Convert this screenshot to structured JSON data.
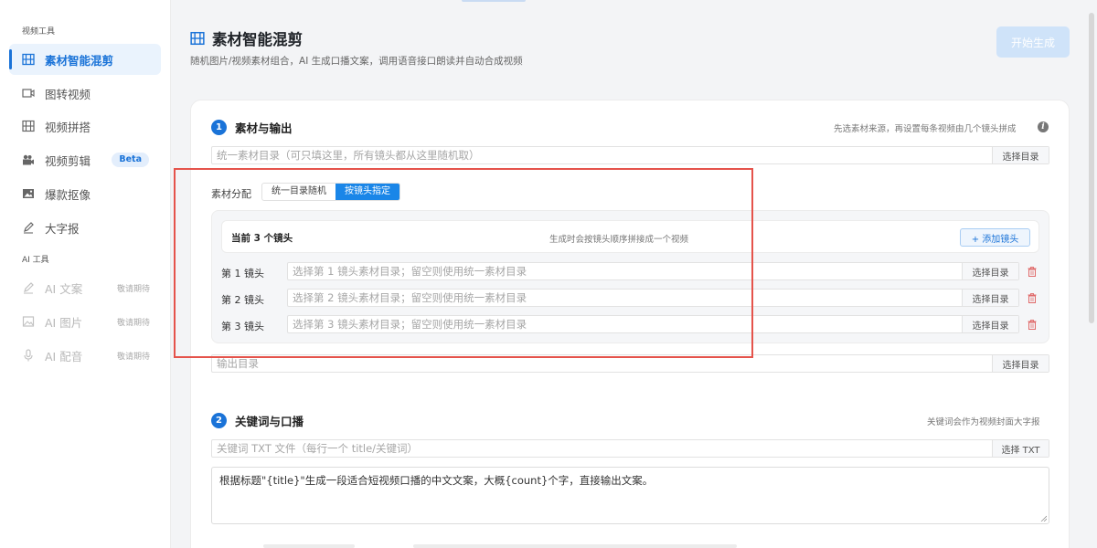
{
  "sidebar": {
    "section_video": "视频工具",
    "section_ai": "AI 工具",
    "items": [
      {
        "label": "素材智能混剪"
      },
      {
        "label": "图转视频"
      },
      {
        "label": "视频拼搭"
      },
      {
        "label": "视频剪辑",
        "badge": "Beta"
      },
      {
        "label": "爆款抠像"
      },
      {
        "label": "大字报"
      }
    ],
    "ai_items": [
      {
        "label": "AI 文案",
        "tag": "敬请期待"
      },
      {
        "label": "AI 图片",
        "tag": "敬请期待"
      },
      {
        "label": "AI 配音",
        "tag": "敬请期待"
      }
    ]
  },
  "header": {
    "title": "素材智能混剪",
    "subtitle": "随机图片/视频素材组合，AI 生成口播文案，调用语音接口朗读并自动合成视频",
    "start_button": "开始生成"
  },
  "section1": {
    "number": "1",
    "title": "素材与输出",
    "hint": "先选素材来源，再设置每条视频由几个镜头拼成",
    "unified_dir_placeholder": "统一素材目录（可只填这里，所有镜头都从这里随机取）",
    "select_dir": "选择目录",
    "allocation_label": "素材分配",
    "allocation_options": [
      "统一目录随机",
      "按镜头指定"
    ],
    "shot_count": "当前 3 个镜头",
    "shot_hint": "生成时会按镜头顺序拼接成一个视频",
    "add_shot": "+ 添加镜头",
    "shots": [
      {
        "label": "第 1 镜头",
        "placeholder": "选择第 1 镜头素材目录；留空则使用统一素材目录"
      },
      {
        "label": "第 2 镜头",
        "placeholder": "选择第 2 镜头素材目录；留空则使用统一素材目录"
      },
      {
        "label": "第 3 镜头",
        "placeholder": "选择第 3 镜头素材目录；留空则使用统一素材目录"
      }
    ],
    "output_dir_placeholder": "输出目录"
  },
  "section2": {
    "number": "2",
    "title": "关键词与口播",
    "hint": "关键词会作为视频封面大字报",
    "keyword_file_placeholder": "关键词 TXT 文件（每行一个 title/关键词）",
    "select_txt": "选择 TXT",
    "prompt_text": "根据标题\"{title}\"生成一段适合短视频口播的中文文案，大概{count}个字，直接输出文案。"
  },
  "colors": {
    "accent": "#1a73d8",
    "highlight": "#e5534b"
  }
}
